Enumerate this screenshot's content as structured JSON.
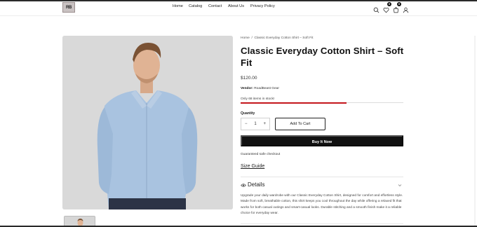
{
  "header": {
    "logo_text": "RB",
    "nav": [
      "Home",
      "Catalog",
      "Contact",
      "About Us",
      "Privacy Policy"
    ],
    "icons": [
      "search-icon",
      "heart-icon",
      "cart-icon",
      "account-icon"
    ],
    "wishlist_count": "0",
    "cart_count": "0"
  },
  "breadcrumb": {
    "home": "Home",
    "separator": "/",
    "current": "Classic Everyday Cotton Shirt – Soft Fit"
  },
  "product": {
    "title": "Classic Everyday Cotton Shirt – Soft Fit",
    "price": "$120.00",
    "vendor_label": "Vendor:",
    "vendor": "RoadBeast Gear",
    "stock_text": "Only 68 items in stock!",
    "stock_fraction": 0.65,
    "quantity_label": "Quantity",
    "quantity_value": "1",
    "minus": "−",
    "plus": "+",
    "add_to_cart": "Add To Cart",
    "buy_now": "Buy It Now",
    "guarantee": "Guaranteed safe checkout",
    "size_guide": "Size Guide",
    "details_label": "Details",
    "details_text": "Upgrade your daily wardrobe with our Classic Everyday Cotton Shirt, designed for comfort and effortless style. Made from soft, breathable cotton, this shirt keeps you cool throughout the day while offering a relaxed fit that works for both casual outings and smart-casual looks. Durable stitching and a smooth finish make it a reliable choice for everyday wear."
  },
  "colors": {
    "accent": "#c4161c",
    "button_dark": "#111111",
    "image_bg": "#d8d8d8",
    "shirt": "#a9c3e0"
  }
}
